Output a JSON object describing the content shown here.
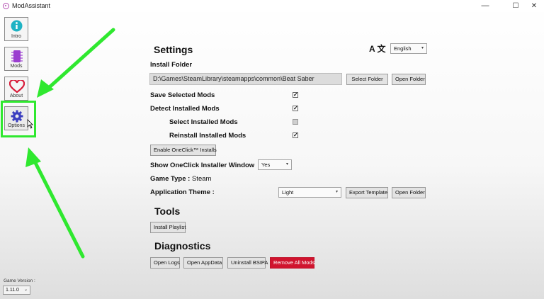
{
  "window": {
    "title": "ModAssistant",
    "minimize": "—",
    "maximize": "☐",
    "close": "✕"
  },
  "sidebar": {
    "items": [
      {
        "label": "Intro",
        "icon": "info-icon",
        "color": "#1fb3c4"
      },
      {
        "label": "Mods",
        "icon": "chip-icon",
        "color": "#9b3fd0"
      },
      {
        "label": "About",
        "icon": "heart-icon",
        "color": "#d81c3a"
      },
      {
        "label": "Options",
        "icon": "gear-icon",
        "color": "#3b3fc0"
      }
    ],
    "game_version_label": "Game Version :",
    "game_version_value": "1.11.0"
  },
  "settings": {
    "heading": "Settings",
    "language_glyph": "A 文",
    "language": "English",
    "install_folder_label": "Install Folder",
    "install_folder_path": "D:\\Games\\SteamLibrary\\steamapps\\common\\Beat Saber",
    "select_folder": "Select Folder",
    "open_folder": "Open Folder",
    "save_selected_mods": "Save Selected Mods",
    "detect_installed_mods": "Detect Installed Mods",
    "select_installed_mods": "Select Installed Mods",
    "reinstall_installed_mods": "Reinstall Installed Mods",
    "enable_oneclick": "Enable OneClick™ Installs",
    "show_oneclick_window": "Show OneClick Installer Window",
    "show_oneclick_value": "Yes",
    "game_type_label": "Game Type :",
    "game_type_value": "Steam",
    "app_theme_label": "Application Theme :",
    "app_theme_value": "Light",
    "export_template": "Export Template",
    "theme_open_folder": "Open Folder"
  },
  "tools": {
    "heading": "Tools",
    "install_playlist": "Install Playlist"
  },
  "diagnostics": {
    "heading": "Diagnostics",
    "open_logs": "Open Logs",
    "open_appdata": "Open AppData",
    "uninstall_bsipa": "Uninstall BSIPA",
    "remove_all_mods": "Remove All Mods"
  },
  "checkboxes": {
    "save_selected_mods": true,
    "detect_installed_mods": true,
    "select_installed_mods": false,
    "reinstall_installed_mods": true
  },
  "annotation_color": "#2fe82f"
}
